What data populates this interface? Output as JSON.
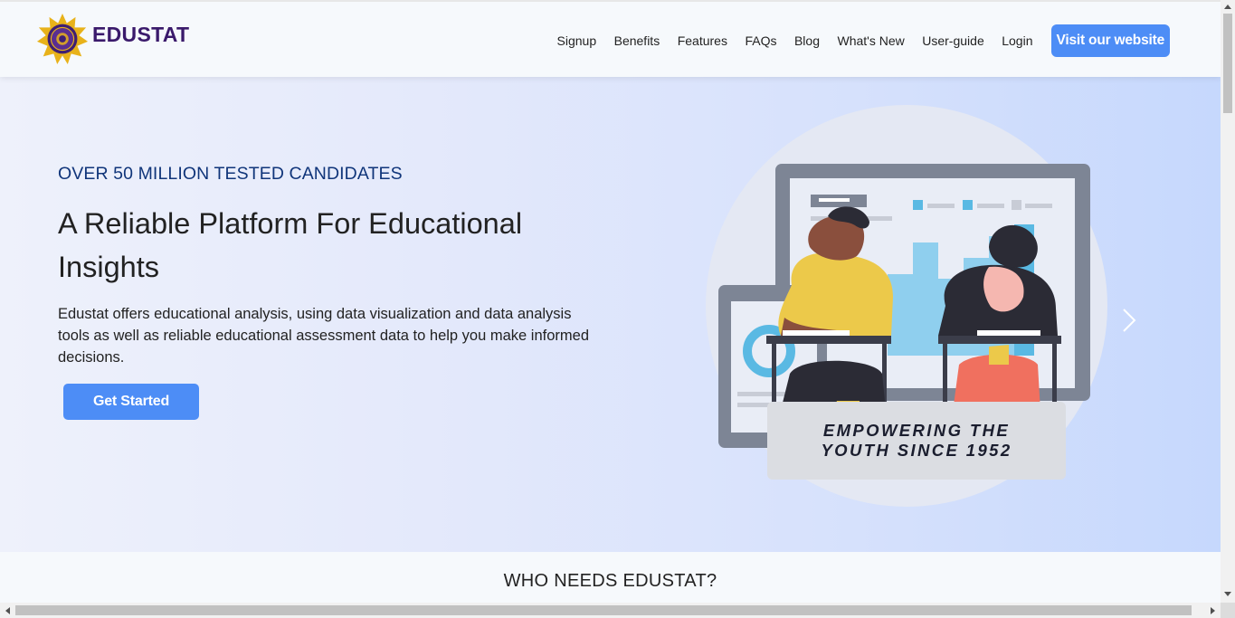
{
  "brand": {
    "name": "EDUSTAT",
    "logo_icon": "waec-seal-icon",
    "accent": "#3a1a6b"
  },
  "nav": {
    "items": [
      {
        "label": "Signup"
      },
      {
        "label": "Benefits"
      },
      {
        "label": "Features"
      },
      {
        "label": "FAQs"
      },
      {
        "label": "Blog"
      },
      {
        "label": "What's New"
      },
      {
        "label": "User-guide"
      },
      {
        "label": "Login"
      }
    ],
    "cta_label": "Visit our website",
    "cta_color": "#4d8df6"
  },
  "hero": {
    "kicker": "OVER 50 MILLION TESTED CANDIDATES",
    "title": "A Reliable Platform For Educational Insights",
    "description": "Edustat offers educational analysis, using data visualization and data analysis tools as well as reliable educational assessment data to help you make informed decisions.",
    "button_label": "Get Started",
    "caption_line1": "EMPOWERING THE",
    "caption_line2": "YOUTH SINCE 1952",
    "next_icon": "chevron-right-icon"
  },
  "section": {
    "heading": "WHO NEEDS EDUSTAT?"
  }
}
